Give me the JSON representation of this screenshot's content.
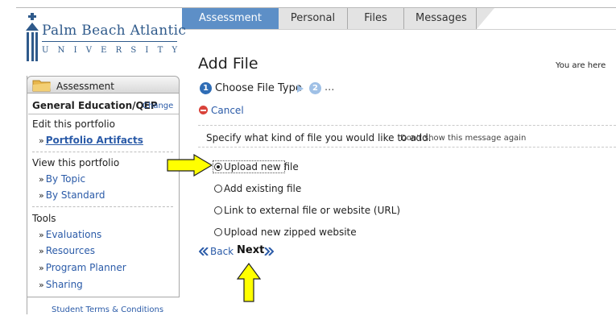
{
  "tabs": [
    {
      "label": "Assessment",
      "active": true
    },
    {
      "label": "Personal",
      "active": false
    },
    {
      "label": "Files",
      "active": false
    },
    {
      "label": "Messages",
      "active": false
    }
  ],
  "logo": {
    "name": "Palm Beach Atlantic",
    "sub": "UNIVERSITY"
  },
  "sidebar": {
    "header": "Assessment",
    "portfolio_name": "General Education/QEP",
    "change_link": "Change",
    "sections": {
      "edit": "Edit this portfolio",
      "view": "View this portfolio",
      "tools": "Tools"
    },
    "links": {
      "artifacts": "Portfolio Artifacts",
      "by_topic": "By Topic",
      "by_standard": "By Standard",
      "evaluations": "Evaluations",
      "resources": "Resources",
      "program_planner": "Program Planner",
      "sharing": "Sharing"
    },
    "footer": "Student Terms & Conditions"
  },
  "main": {
    "title": "Add File",
    "breadcrumb_hint": "You are here",
    "steps": {
      "step1_num": "1",
      "step1_label": "Choose File Type",
      "step2_num": "2",
      "step2_label": "..."
    },
    "cancel": "Cancel",
    "instruction": "Specify what kind of file you would like to add.",
    "dont_show": "Don't show this message again",
    "options": [
      {
        "label": "Upload new file",
        "selected": true
      },
      {
        "label": "Add existing file",
        "selected": false
      },
      {
        "label": "Link to external file or website (URL)",
        "selected": false
      },
      {
        "label": "Upload new zipped website",
        "selected": false
      }
    ],
    "back": "Back",
    "next": "Next"
  },
  "colors": {
    "active_tab": "#5d8fc7",
    "link": "#2b5ba8",
    "arrow_fill": "#ffff00",
    "cancel_icon": "#d9423a"
  }
}
